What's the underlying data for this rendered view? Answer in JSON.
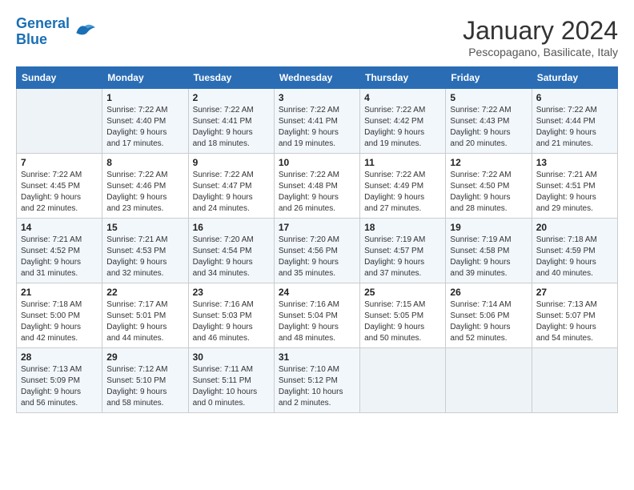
{
  "header": {
    "logo_line1": "General",
    "logo_line2": "Blue",
    "month": "January 2024",
    "location": "Pescopagano, Basilicate, Italy"
  },
  "days_of_week": [
    "Sunday",
    "Monday",
    "Tuesday",
    "Wednesday",
    "Thursday",
    "Friday",
    "Saturday"
  ],
  "weeks": [
    [
      {
        "day": "",
        "info": ""
      },
      {
        "day": "1",
        "info": "Sunrise: 7:22 AM\nSunset: 4:40 PM\nDaylight: 9 hours\nand 17 minutes."
      },
      {
        "day": "2",
        "info": "Sunrise: 7:22 AM\nSunset: 4:41 PM\nDaylight: 9 hours\nand 18 minutes."
      },
      {
        "day": "3",
        "info": "Sunrise: 7:22 AM\nSunset: 4:41 PM\nDaylight: 9 hours\nand 19 minutes."
      },
      {
        "day": "4",
        "info": "Sunrise: 7:22 AM\nSunset: 4:42 PM\nDaylight: 9 hours\nand 19 minutes."
      },
      {
        "day": "5",
        "info": "Sunrise: 7:22 AM\nSunset: 4:43 PM\nDaylight: 9 hours\nand 20 minutes."
      },
      {
        "day": "6",
        "info": "Sunrise: 7:22 AM\nSunset: 4:44 PM\nDaylight: 9 hours\nand 21 minutes."
      }
    ],
    [
      {
        "day": "7",
        "info": "Sunrise: 7:22 AM\nSunset: 4:45 PM\nDaylight: 9 hours\nand 22 minutes."
      },
      {
        "day": "8",
        "info": "Sunrise: 7:22 AM\nSunset: 4:46 PM\nDaylight: 9 hours\nand 23 minutes."
      },
      {
        "day": "9",
        "info": "Sunrise: 7:22 AM\nSunset: 4:47 PM\nDaylight: 9 hours\nand 24 minutes."
      },
      {
        "day": "10",
        "info": "Sunrise: 7:22 AM\nSunset: 4:48 PM\nDaylight: 9 hours\nand 26 minutes."
      },
      {
        "day": "11",
        "info": "Sunrise: 7:22 AM\nSunset: 4:49 PM\nDaylight: 9 hours\nand 27 minutes."
      },
      {
        "day": "12",
        "info": "Sunrise: 7:22 AM\nSunset: 4:50 PM\nDaylight: 9 hours\nand 28 minutes."
      },
      {
        "day": "13",
        "info": "Sunrise: 7:21 AM\nSunset: 4:51 PM\nDaylight: 9 hours\nand 29 minutes."
      }
    ],
    [
      {
        "day": "14",
        "info": "Sunrise: 7:21 AM\nSunset: 4:52 PM\nDaylight: 9 hours\nand 31 minutes."
      },
      {
        "day": "15",
        "info": "Sunrise: 7:21 AM\nSunset: 4:53 PM\nDaylight: 9 hours\nand 32 minutes."
      },
      {
        "day": "16",
        "info": "Sunrise: 7:20 AM\nSunset: 4:54 PM\nDaylight: 9 hours\nand 34 minutes."
      },
      {
        "day": "17",
        "info": "Sunrise: 7:20 AM\nSunset: 4:56 PM\nDaylight: 9 hours\nand 35 minutes."
      },
      {
        "day": "18",
        "info": "Sunrise: 7:19 AM\nSunset: 4:57 PM\nDaylight: 9 hours\nand 37 minutes."
      },
      {
        "day": "19",
        "info": "Sunrise: 7:19 AM\nSunset: 4:58 PM\nDaylight: 9 hours\nand 39 minutes."
      },
      {
        "day": "20",
        "info": "Sunrise: 7:18 AM\nSunset: 4:59 PM\nDaylight: 9 hours\nand 40 minutes."
      }
    ],
    [
      {
        "day": "21",
        "info": "Sunrise: 7:18 AM\nSunset: 5:00 PM\nDaylight: 9 hours\nand 42 minutes."
      },
      {
        "day": "22",
        "info": "Sunrise: 7:17 AM\nSunset: 5:01 PM\nDaylight: 9 hours\nand 44 minutes."
      },
      {
        "day": "23",
        "info": "Sunrise: 7:16 AM\nSunset: 5:03 PM\nDaylight: 9 hours\nand 46 minutes."
      },
      {
        "day": "24",
        "info": "Sunrise: 7:16 AM\nSunset: 5:04 PM\nDaylight: 9 hours\nand 48 minutes."
      },
      {
        "day": "25",
        "info": "Sunrise: 7:15 AM\nSunset: 5:05 PM\nDaylight: 9 hours\nand 50 minutes."
      },
      {
        "day": "26",
        "info": "Sunrise: 7:14 AM\nSunset: 5:06 PM\nDaylight: 9 hours\nand 52 minutes."
      },
      {
        "day": "27",
        "info": "Sunrise: 7:13 AM\nSunset: 5:07 PM\nDaylight: 9 hours\nand 54 minutes."
      }
    ],
    [
      {
        "day": "28",
        "info": "Sunrise: 7:13 AM\nSunset: 5:09 PM\nDaylight: 9 hours\nand 56 minutes."
      },
      {
        "day": "29",
        "info": "Sunrise: 7:12 AM\nSunset: 5:10 PM\nDaylight: 9 hours\nand 58 minutes."
      },
      {
        "day": "30",
        "info": "Sunrise: 7:11 AM\nSunset: 5:11 PM\nDaylight: 10 hours\nand 0 minutes."
      },
      {
        "day": "31",
        "info": "Sunrise: 7:10 AM\nSunset: 5:12 PM\nDaylight: 10 hours\nand 2 minutes."
      },
      {
        "day": "",
        "info": ""
      },
      {
        "day": "",
        "info": ""
      },
      {
        "day": "",
        "info": ""
      }
    ]
  ]
}
